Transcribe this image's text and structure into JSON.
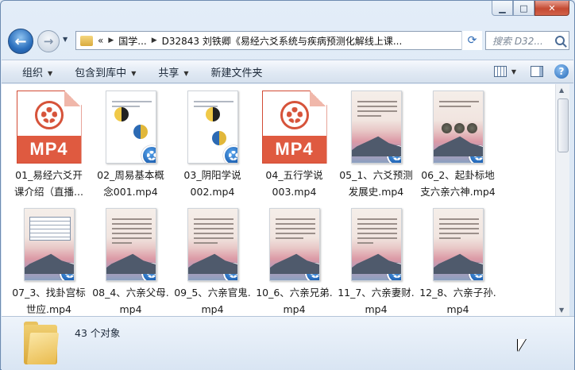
{
  "window": {
    "caption_buttons": [
      "minimize",
      "maximize",
      "close"
    ]
  },
  "address": {
    "crumbs": [
      "国学...",
      "D32843 刘铁卿《易经六爻系统与疾病预测化解线上课..."
    ],
    "leading_chevrons": "«"
  },
  "search": {
    "placeholder": "搜索 D32..."
  },
  "toolbar": {
    "organize": "组织",
    "include_in_library": "包含到库中",
    "share": "共享",
    "new_folder": "新建文件夹"
  },
  "files": [
    {
      "name": "01_易经六爻开课介绍（直播...",
      "thumb": "mp4-icon"
    },
    {
      "name": "02_周易基本概念001.mp4",
      "thumb": "video-doc-yinyang"
    },
    {
      "name": "03_阴阳学说002.mp4",
      "thumb": "video-doc-yinyang"
    },
    {
      "name": "04_五行学说003.mp4",
      "thumb": "mp4-icon"
    },
    {
      "name": "05_1、六爻预测发展史.mp4",
      "thumb": "video-sunset"
    },
    {
      "name": "06_2、起卦标地支六亲六神.mp4",
      "thumb": "video-sunset-coins"
    },
    {
      "name": "07_3、找卦宫标世应.mp4",
      "thumb": "video-table"
    },
    {
      "name": "08_4、六亲父母.mp4",
      "thumb": "video-sunset"
    },
    {
      "name": "09_5、六亲官鬼.mp4",
      "thumb": "video-sunset"
    },
    {
      "name": "10_6、六亲兄弟.mp4",
      "thumb": "video-sunset"
    },
    {
      "name": "11_7、六亲妻财.mp4",
      "thumb": "video-sunset"
    },
    {
      "name": "12_8、六亲子孙.mp4",
      "thumb": "video-sunset"
    }
  ],
  "labels": {
    "f0": [
      "01_易经六爻开",
      "课介绍（直播..."
    ],
    "f1": [
      "02_周易基本概",
      "念001.mp4"
    ],
    "f2": [
      "03_阴阳学说",
      "002.mp4"
    ],
    "f3": [
      "04_五行学说",
      "003.mp4"
    ],
    "f4": [
      "05_1、六爻预测",
      "发展史.mp4"
    ],
    "f5": [
      "06_2、起卦标地",
      "支六亲六神.mp4"
    ],
    "f6": [
      "07_3、找卦宫标",
      "世应.mp4"
    ],
    "f7": [
      "08_4、六亲父母.",
      "mp4"
    ],
    "f8": [
      "09_5、六亲官鬼.",
      "mp4"
    ],
    "f9": [
      "10_6、六亲兄弟.",
      "mp4"
    ],
    "f10": [
      "11_7、六亲妻财.",
      "mp4"
    ],
    "f11": [
      "12_8、六亲子孙.",
      "mp4"
    ]
  },
  "mp4_text": "MP4",
  "status": {
    "count_text": "43 个对象"
  }
}
